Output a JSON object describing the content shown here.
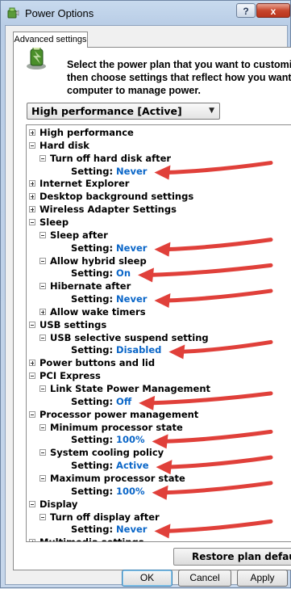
{
  "window": {
    "title": "Power Options",
    "help_label": "?",
    "close_label": "x"
  },
  "tab": {
    "label": "Advanced settings"
  },
  "description": {
    "line1": "Select the power plan that you want to customize",
    "line2": "then choose settings that reflect how you want y",
    "line3": "computer to manage power."
  },
  "plan_select": {
    "value": "High performance [Active]"
  },
  "tree": [
    {
      "type": "group",
      "label": "High performance",
      "state": "plus",
      "level": 0
    },
    {
      "type": "group",
      "label": "Hard disk",
      "state": "minus",
      "level": 0
    },
    {
      "type": "group",
      "label": "Turn off hard disk after",
      "state": "minus",
      "level": 1
    },
    {
      "type": "setting",
      "label": "Setting:",
      "value": "Never",
      "level": 2
    },
    {
      "type": "group",
      "label": "Internet Explorer",
      "state": "plus",
      "level": 0
    },
    {
      "type": "group",
      "label": "Desktop background settings",
      "state": "plus",
      "level": 0
    },
    {
      "type": "group",
      "label": "Wireless Adapter Settings",
      "state": "plus",
      "level": 0
    },
    {
      "type": "group",
      "label": "Sleep",
      "state": "minus",
      "level": 0
    },
    {
      "type": "group",
      "label": "Sleep after",
      "state": "minus",
      "level": 1
    },
    {
      "type": "setting",
      "label": "Setting:",
      "value": "Never",
      "level": 2
    },
    {
      "type": "group",
      "label": "Allow hybrid sleep",
      "state": "minus",
      "level": 1
    },
    {
      "type": "setting",
      "label": "Setting:",
      "value": "On",
      "level": 2
    },
    {
      "type": "group",
      "label": "Hibernate after",
      "state": "minus",
      "level": 1
    },
    {
      "type": "setting",
      "label": "Setting:",
      "value": "Never",
      "level": 2
    },
    {
      "type": "group",
      "label": "Allow wake timers",
      "state": "plus",
      "level": 1
    },
    {
      "type": "group",
      "label": "USB settings",
      "state": "minus",
      "level": 0
    },
    {
      "type": "group",
      "label": "USB selective suspend setting",
      "state": "minus",
      "level": 1
    },
    {
      "type": "setting",
      "label": "Setting:",
      "value": "Disabled",
      "level": 2
    },
    {
      "type": "group",
      "label": "Power buttons and lid",
      "state": "plus",
      "level": 0
    },
    {
      "type": "group",
      "label": "PCI Express",
      "state": "minus",
      "level": 0
    },
    {
      "type": "group",
      "label": "Link State Power Management",
      "state": "minus",
      "level": 1
    },
    {
      "type": "setting",
      "label": "Setting:",
      "value": "Off",
      "level": 2
    },
    {
      "type": "group",
      "label": "Processor power management",
      "state": "minus",
      "level": 0
    },
    {
      "type": "group",
      "label": "Minimum processor state",
      "state": "minus",
      "level": 1
    },
    {
      "type": "setting",
      "label": "Setting:",
      "value": "100%",
      "level": 2
    },
    {
      "type": "group",
      "label": "System cooling policy",
      "state": "minus",
      "level": 1
    },
    {
      "type": "setting",
      "label": "Setting:",
      "value": "Active",
      "level": 2
    },
    {
      "type": "group",
      "label": "Maximum processor state",
      "state": "minus",
      "level": 1
    },
    {
      "type": "setting",
      "label": "Setting:",
      "value": "100%",
      "level": 2
    },
    {
      "type": "group",
      "label": "Display",
      "state": "minus",
      "level": 0
    },
    {
      "type": "group",
      "label": "Turn off display after",
      "state": "minus",
      "level": 1
    },
    {
      "type": "setting",
      "label": "Setting:",
      "value": "Never",
      "level": 2
    },
    {
      "type": "group",
      "label": "Multimedia settings",
      "state": "plus",
      "level": 0
    }
  ],
  "buttons": {
    "restore": "Restore plan default",
    "ok": "OK",
    "cancel": "Cancel",
    "apply": "Apply"
  },
  "colors": {
    "setting_value": "#0a66c8",
    "annotation_arrow": "#e0403a"
  }
}
